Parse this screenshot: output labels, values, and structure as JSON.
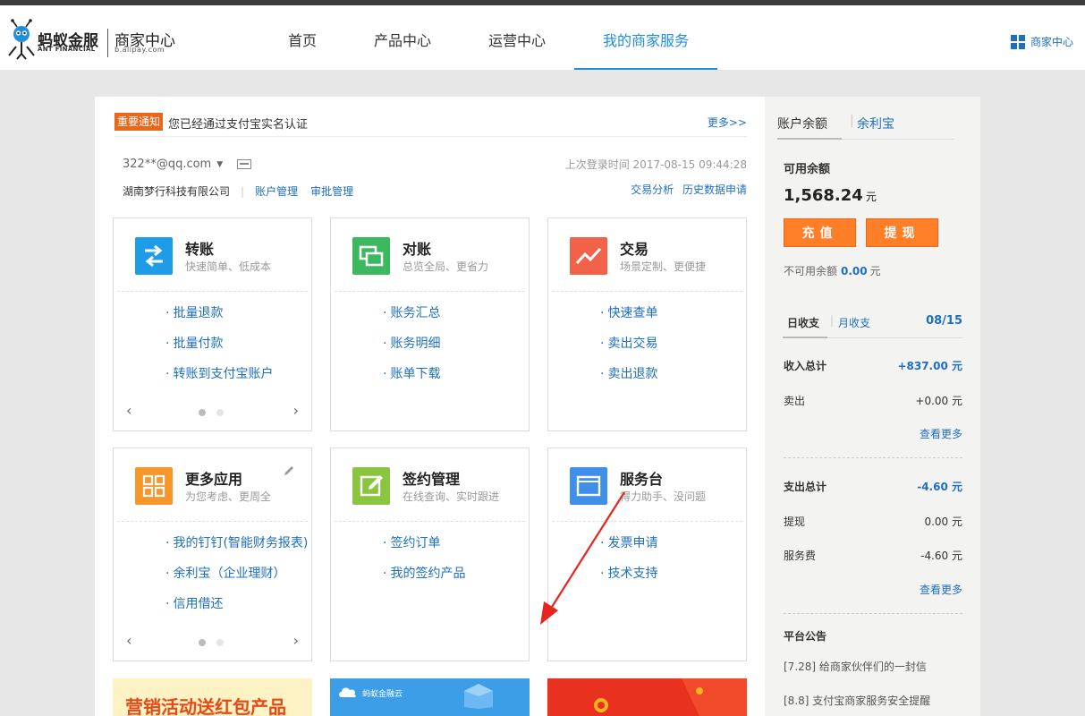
{
  "header": {
    "logo_cn": "蚂蚁金服",
    "logo_en": "ANT FINANCIAL",
    "logo_cn2": "商家中心",
    "logo_en2": "b.alipay.com",
    "nav": [
      "首页",
      "产品中心",
      "运营中心",
      "我的商家服务"
    ],
    "active_nav": "我的商家服务",
    "merchant_link": "商家中心"
  },
  "notice": {
    "badge": "重要通知",
    "text": "您已经通过支付宝实名认证",
    "more": "更多>>"
  },
  "account": {
    "email": "322**@qq.com",
    "last_login": "上次登录时间 2017-08-15 09:44:28",
    "company": "湖南梦行科技有限公司",
    "links": [
      "账户管理",
      "审批管理"
    ],
    "quick_links": [
      "交易分析",
      "历史数据申请"
    ]
  },
  "cards": [
    {
      "title": "转账",
      "sub": "快速简单、低成本",
      "icon": "transfer-icon",
      "color": "#1f9ce8",
      "items": [
        "批量退款",
        "批量付款",
        "转账到支付宝账户"
      ],
      "pager": true
    },
    {
      "title": "对账",
      "sub": "总览全局、更省力",
      "icon": "reconcile-icon",
      "color": "#3cb960",
      "items": [
        "账务汇总",
        "账务明细",
        "账单下载"
      ],
      "pager": false
    },
    {
      "title": "交易",
      "sub": "场景定制、更便捷",
      "icon": "trade-chart-icon",
      "color": "#f2624a",
      "items": [
        "快速查单",
        "卖出交易",
        "卖出退款"
      ],
      "pager": false
    },
    {
      "title": "更多应用",
      "sub": "为您考虑、更周全",
      "icon": "apps-grid-icon",
      "color": "#f7962a",
      "items": [
        "我的钉钉(智能财务报表)",
        "余利宝（企业理财）",
        "信用借还"
      ],
      "pager": true
    },
    {
      "title": "签约管理",
      "sub": "在线查询、实时跟进",
      "icon": "contract-edit-icon",
      "color": "#8bc53f",
      "items": [
        "签约订单",
        "我的签约产品"
      ],
      "pager": false
    },
    {
      "title": "服务台",
      "sub": "得力助手、没问题",
      "icon": "service-window-icon",
      "color": "#3f8ee8",
      "items": [
        "发票申请",
        "技术支持"
      ],
      "pager": false
    }
  ],
  "banners": {
    "b1": "营销活动送红包产品",
    "b2": "蚂蚁金融云"
  },
  "side": {
    "tab1": "账户余额",
    "tab2": "余利宝",
    "avail_label": "可用余额",
    "avail_amount": "1,568.24",
    "unit": "元",
    "recharge": "充值",
    "withdraw": "提现",
    "unavail_label": "不可用余额",
    "unavail_amount": "0.00",
    "day_tab": "日收支",
    "month_tab": "月收支",
    "date": "08/15",
    "income_label": "收入总计",
    "income_total": "+837.00 元",
    "sell_label": "卖出",
    "sell_value": "+0.00 元",
    "more1": "查看更多",
    "expense_label": "支出总计",
    "expense_total": "-4.60 元",
    "withdraw_label": "提现",
    "withdraw_value": "0.00 元",
    "fee_label": "服务费",
    "fee_value": "-4.60 元",
    "more2": "查看更多",
    "announce_title": "平台公告",
    "announcements": [
      "[7.28] 给商家伙伴们的一封信",
      "[8.8] 支付宝商家服务安全提醒"
    ]
  },
  "colors": {
    "accent": "#1f8fdc",
    "link": "#1f6fbf",
    "orange": "#ff7e28",
    "arrow": "#e8241c"
  }
}
